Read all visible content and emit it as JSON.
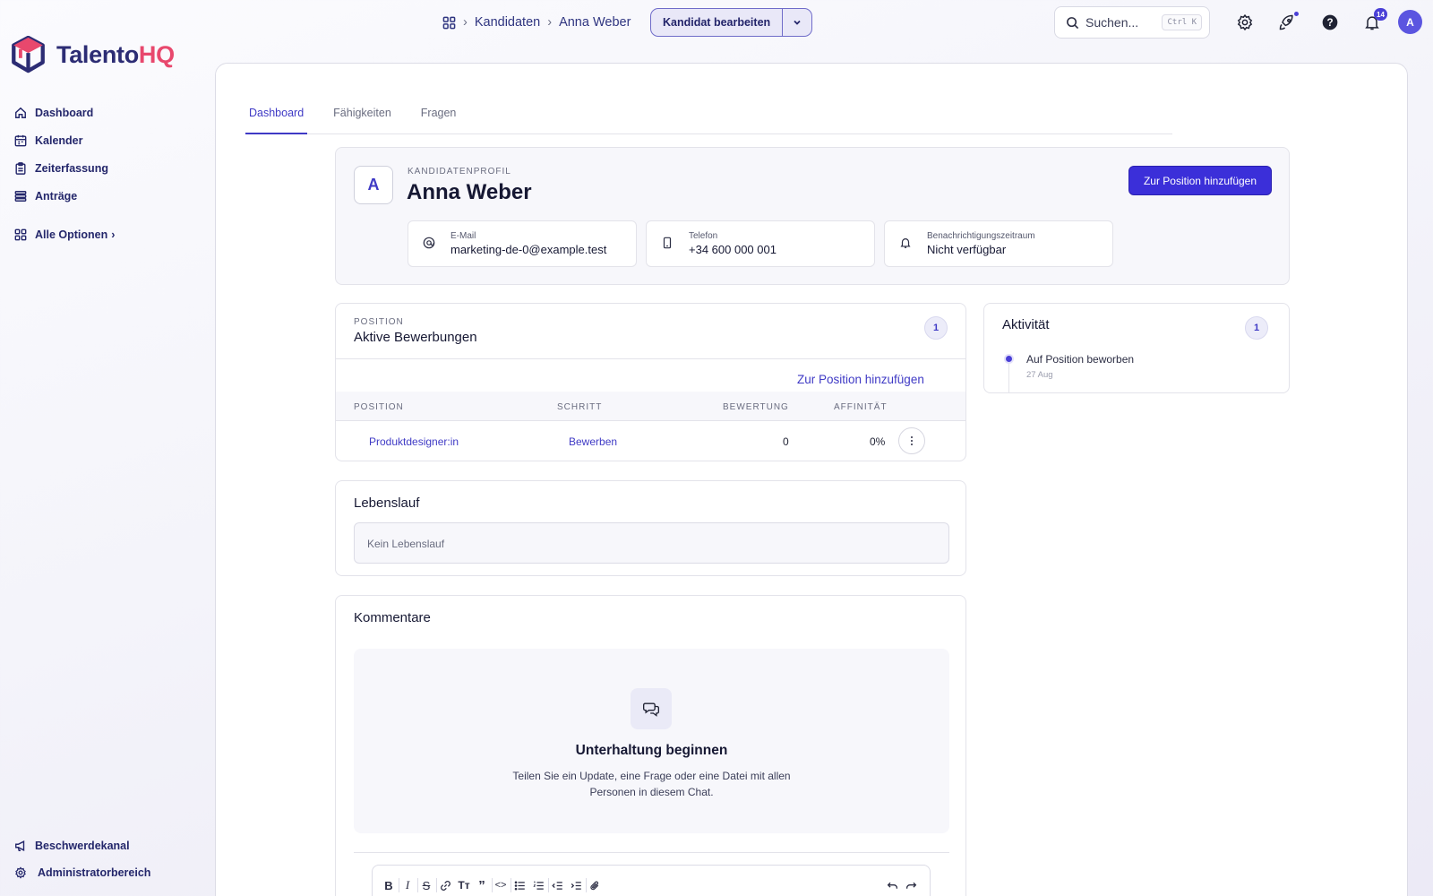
{
  "brand": {
    "logo_text_1": "Talento",
    "logo_text_2": "HQ"
  },
  "breadcrumb": {
    "section": "Kandidaten",
    "current": "Anna Weber"
  },
  "header": {
    "edit_button": "Kandidat bearbeiten",
    "search_placeholder": "Suchen...",
    "search_shortcut": "Ctrl K",
    "notification_count": "14",
    "user_initial": "A"
  },
  "sidebar": {
    "items": [
      {
        "label": "Dashboard",
        "icon": "home-icon"
      },
      {
        "label": "Kalender",
        "icon": "calendar-icon"
      },
      {
        "label": "Zeiterfassung",
        "icon": "clipboard-icon"
      },
      {
        "label": "Anträge",
        "icon": "stack-icon"
      }
    ],
    "all_options": "Alle Optionen",
    "bottom": [
      {
        "label": "Beschwerdekanal",
        "icon": "megaphone-icon"
      },
      {
        "label": "Administratorbereich",
        "icon": "gear-icon"
      }
    ]
  },
  "tabs": [
    "Dashboard",
    "Fähigkeiten",
    "Fragen"
  ],
  "active_tab": "Dashboard",
  "profile": {
    "eyebrow": "KANDIDATENPROFIL",
    "initial": "A",
    "name": "Anna Weber",
    "add_to_position": "Zur Position hinzufügen",
    "email_label": "E-Mail",
    "email": "marketing-de-0@example.test",
    "phone_label": "Telefon",
    "phone": "+34 600 000 001",
    "notice_label": "Benachrichtigungszeitraum",
    "notice": "Nicht verfügbar"
  },
  "applications": {
    "eyebrow": "POSITION",
    "title": "Aktive Bewerbungen",
    "count": "1",
    "add_link": "Zur Position hinzufügen",
    "columns": [
      "POSITION",
      "SCHRITT",
      "BEWERTUNG",
      "AFFINITÄT"
    ],
    "rows": [
      {
        "position": "Produktdesigner:in",
        "step": "Bewerben",
        "rating": "0",
        "affinity": "0%"
      }
    ]
  },
  "activity": {
    "title": "Aktivität",
    "count": "1",
    "events": [
      {
        "text": "Auf Position beworben",
        "date": "27 Aug"
      }
    ]
  },
  "resume": {
    "title": "Lebenslauf",
    "empty": "Kein Lebenslauf"
  },
  "comments": {
    "title": "Kommentare",
    "empty_title": "Unterhaltung beginnen",
    "empty_text": "Teilen Sie ein Update, eine Frage oder eine Datei mit allen Personen in diesem Chat."
  },
  "colors": {
    "accent": "#3b2fd9",
    "brand_navy": "#2c2c74",
    "brand_pink": "#e8486d"
  }
}
